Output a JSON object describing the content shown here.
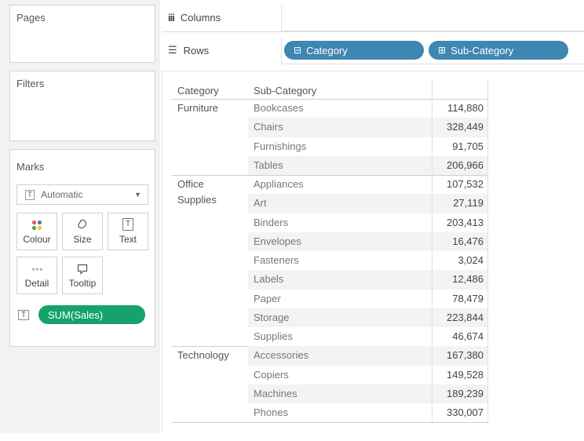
{
  "colors": {
    "pill_dimension": "#3f86b3",
    "pill_measure": "#16a36b",
    "panel_bg": "#f2f2f2"
  },
  "cards": {
    "pages": "Pages",
    "filters": "Filters",
    "marks": "Marks"
  },
  "marks": {
    "type": "Automatic",
    "type_icon": "T",
    "buttons": {
      "colour": "Colour",
      "size": "Size",
      "text": "Text",
      "detail": "Detail",
      "tooltip": "Tooltip"
    },
    "measure_icon": "T",
    "measure_pill": "SUM(Sales)"
  },
  "shelves": {
    "columns_icon": "iii",
    "columns": "Columns",
    "rows_icon": "☰",
    "rows": "Rows",
    "rows_pills": [
      {
        "label": "Category",
        "glyph": "⊟"
      },
      {
        "label": "Sub-Category",
        "glyph": "⊞"
      }
    ]
  },
  "table": {
    "headers": {
      "category": "Category",
      "subcategory": "Sub-Category"
    },
    "groups": [
      {
        "category": "Furniture",
        "rows": [
          {
            "sub": "Bookcases",
            "value": "114,880"
          },
          {
            "sub": "Chairs",
            "value": "328,449"
          },
          {
            "sub": "Furnishings",
            "value": "91,705"
          },
          {
            "sub": "Tables",
            "value": "206,966"
          }
        ]
      },
      {
        "category": "Office Supplies",
        "category_lines": [
          "Office",
          "Supplies"
        ],
        "rows": [
          {
            "sub": "Appliances",
            "value": "107,532"
          },
          {
            "sub": "Art",
            "value": "27,119"
          },
          {
            "sub": "Binders",
            "value": "203,413"
          },
          {
            "sub": "Envelopes",
            "value": "16,476"
          },
          {
            "sub": "Fasteners",
            "value": "3,024"
          },
          {
            "sub": "Labels",
            "value": "12,486"
          },
          {
            "sub": "Paper",
            "value": "78,479"
          },
          {
            "sub": "Storage",
            "value": "223,844"
          },
          {
            "sub": "Supplies",
            "value": "46,674"
          }
        ]
      },
      {
        "category": "Technology",
        "rows": [
          {
            "sub": "Accessories",
            "value": "167,380"
          },
          {
            "sub": "Copiers",
            "value": "149,528"
          },
          {
            "sub": "Machines",
            "value": "189,239"
          },
          {
            "sub": "Phones",
            "value": "330,007"
          }
        ]
      }
    ]
  }
}
